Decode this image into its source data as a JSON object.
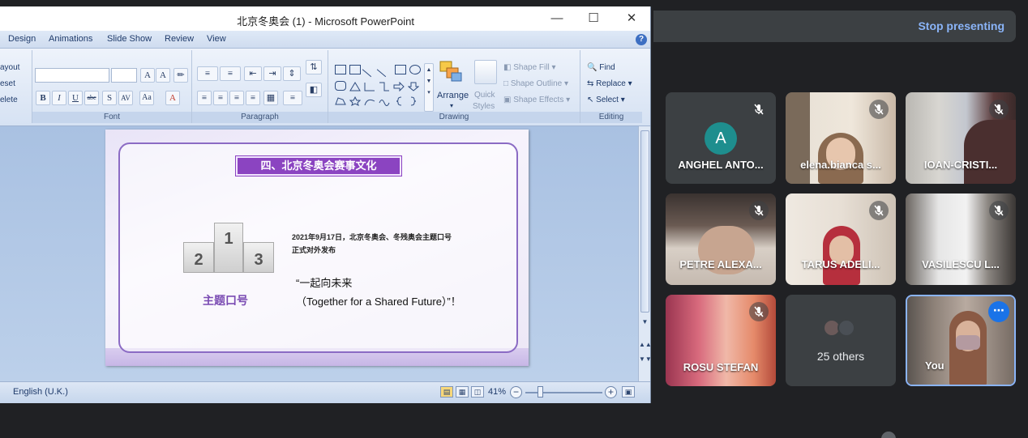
{
  "window": {
    "title": "北京冬奥会 (1) - Microsoft PowerPoint"
  },
  "ribbon": {
    "tabs": [
      "Design",
      "Animations",
      "Slide Show",
      "Review",
      "View"
    ],
    "left_labels": [
      "ayout",
      "eset",
      "elete"
    ],
    "groups": {
      "font": "Font",
      "paragraph": "Paragraph",
      "drawing": "Drawing",
      "editing": "Editing"
    },
    "drawing": {
      "arrange": "Arrange",
      "quick": "Quick",
      "styles": "Styles",
      "shape_fill": "Shape Fill",
      "shape_outline": "Shape Outline",
      "shape_effects": "Shape Effects"
    },
    "editing": {
      "find": "Find",
      "replace": "Replace",
      "select": "Select"
    }
  },
  "slide": {
    "title": "四、北京冬奥会赛事文化",
    "podium": [
      "1",
      "2",
      "3"
    ],
    "slogan_label": "主题口号",
    "date_line1": "2021年9月17日，北京冬奥会、冬残奥会主题口号",
    "date_line2": "正式对外发布",
    "slogan_cn": "“一起向未来",
    "slogan_en": "（Together for a Shared Future）”！"
  },
  "status": {
    "language": "English (U.K.)",
    "zoom": "41%"
  },
  "meet": {
    "stop_presenting": "Stop presenting",
    "participants": [
      {
        "name": "ANGHEL ANTO...",
        "avatar": "A"
      },
      {
        "name": "elena.bianca s..."
      },
      {
        "name": "IOAN-CRISTI..."
      },
      {
        "name": "PETRE ALEXA..."
      },
      {
        "name": "TARUS ADELI..."
      },
      {
        "name": "VASILESCU L..."
      },
      {
        "name": "ROSU STEFAN"
      },
      {
        "name": "25 others"
      },
      {
        "name": "You"
      }
    ]
  }
}
